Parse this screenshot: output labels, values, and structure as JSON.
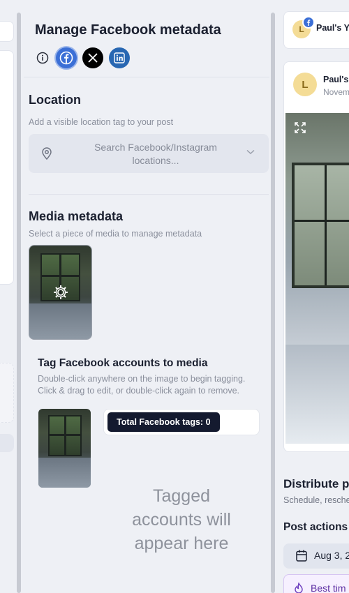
{
  "panel": {
    "title": "Manage Facebook metadata",
    "icons": [
      "info-icon",
      "facebook-icon",
      "x-icon",
      "linkedin-icon"
    ]
  },
  "location": {
    "title": "Location",
    "subtitle": "Add a visible location tag to your post",
    "placeholder": "Search Facebook/Instagram locations..."
  },
  "media_metadata": {
    "title": "Media metadata",
    "subtitle": "Select a piece of media to manage metadata"
  },
  "tagging": {
    "title": "Tag Facebook accounts to media",
    "help": "Double-click anywhere on the image to begin tagging. Click & drag to edit, or double-click again to remove.",
    "total_label": "Total Facebook tags: 0",
    "empty_message": "Tagged accounts will appear here"
  },
  "preview": {
    "account_name_top": "Paul's Yo",
    "avatar_letter": "L",
    "account_name": "Paul's",
    "date": "Novem"
  },
  "distribute": {
    "title": "Distribute p",
    "subtitle": "Schedule, resche",
    "post_actions": "Post actions",
    "date_button": "Aug 3, 2",
    "best_time": "Best tim"
  },
  "colors": {
    "facebook": "#3b6fd6",
    "linkedin": "#2867b2",
    "x": "#000000",
    "pill": "#141a2f",
    "avatar": "#f4dc96",
    "best_time": "#5d2fa3"
  }
}
